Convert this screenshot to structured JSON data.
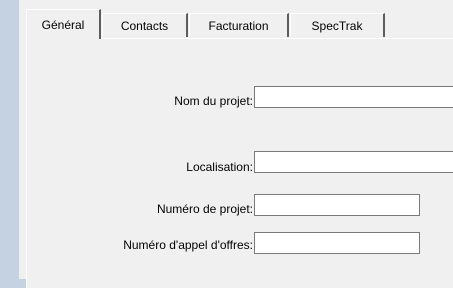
{
  "tabs": [
    {
      "label": "Général",
      "active": true
    },
    {
      "label": "Contacts",
      "active": false
    },
    {
      "label": "Facturation",
      "active": false
    },
    {
      "label": "SpecTrak",
      "active": false
    }
  ],
  "form": {
    "nom_projet": {
      "label": "Nom du projet:",
      "value": ""
    },
    "localisation": {
      "label": "Localisation:",
      "value": ""
    },
    "numero_projet": {
      "label": "Numéro de projet:",
      "value": ""
    },
    "numero_appel_offres": {
      "label": "Numéro d'appel d'offres:",
      "value": ""
    }
  },
  "colors": {
    "window_background": "#f0f0f0",
    "outer_background": "#c5d2e1",
    "input_background": "#ffffff",
    "input_border": "#7a7a7a",
    "tab_shadow": "#5e5e5e"
  }
}
